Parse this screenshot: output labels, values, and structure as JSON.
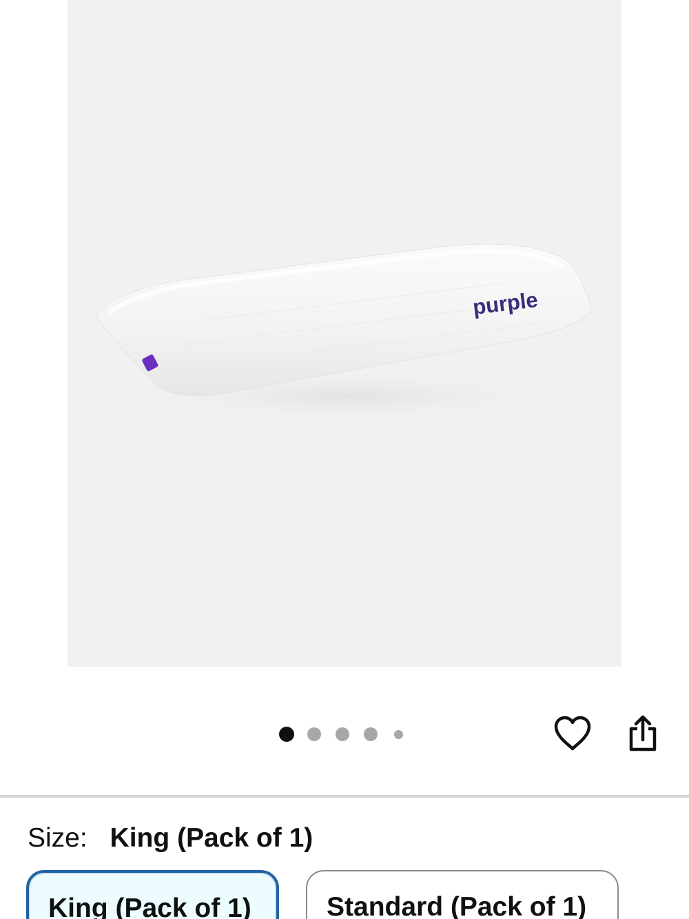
{
  "product_image": {
    "brand_logo_text": "purple",
    "alt": "Purple pillow"
  },
  "carousel": {
    "total_dots": 5,
    "active_index": 0
  },
  "actions": {
    "wishlist_icon": "heart-icon",
    "share_icon": "share-icon"
  },
  "size_selector": {
    "label": "Size:",
    "selected_value": "King (Pack of 1)",
    "options": [
      {
        "label": "King (Pack of 1)",
        "selected": true
      },
      {
        "label": "Standard (Pack of 1)",
        "selected": false
      }
    ]
  },
  "colors": {
    "selected_border": "#2162a1",
    "selected_bg": "#edfdff",
    "brand_purple": "#3b2a7a"
  }
}
